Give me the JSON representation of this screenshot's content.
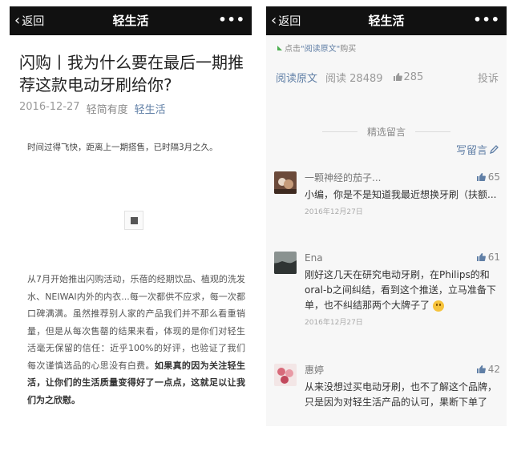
{
  "left": {
    "nav": {
      "back_label": "返回",
      "title": "轻生活",
      "more": "•••"
    },
    "article": {
      "title": "闪购丨我为什么要在最后一期推荐这款电动牙刷给你?",
      "date": "2016-12-27",
      "author": "轻简有度",
      "account": "轻生活",
      "intro": "时间过得飞快，距离上一期搭售，已时隔3月之久。",
      "body": "从7月开始推出闪购活动，乐蓓的经期饮品、植观的洗发水、NEIWAI内外的内衣...每一次都供不应求，每一次都口碑满满。虽然推荐别人家的产品我们并不那么看重销量，但是从每次售罄的结果来看，体现的是你们对轻生活毫无保留的信任：近乎100%的好评，也验证了我们每次谨慎选品的心思没有白费。",
      "body_strong": "如果真的因为关注轻生活，让你们的生活质量变得好了一点点，这就足以让我们为之欣慰。"
    }
  },
  "right": {
    "nav": {
      "back_label": "返回",
      "title": "轻生活",
      "more": "•••"
    },
    "read_original_hint": {
      "prefix": "点击",
      "link": "\"阅读原文\"",
      "suffix": "购买"
    },
    "stats": {
      "read_more": "阅读原文",
      "reads": "阅读 28489",
      "likes": "285",
      "report": "投诉"
    },
    "section_label": "精选留言",
    "write_comment": "写留言",
    "comments": [
      {
        "nick": "一颗神经的茄子...",
        "likes": "65",
        "text": "小编，你是不是知道我最近想换牙刷（扶额...",
        "date": "2016年12月27日"
      },
      {
        "nick": "Ena",
        "likes": "61",
        "text": "刚好这几天在研究电动牙刷，在Philips的和oral-b之间纠结，看到这个推送，立马准备下单，也不纠结那两个大牌子了",
        "date": "2016年12月27日"
      },
      {
        "nick": "惠婷",
        "likes": "42",
        "text": "从来没想过买电动牙刷，也不了解这个品牌，只是因为对轻生活产品的认可，果断下单了",
        "date": ""
      }
    ],
    "colors": {
      "link": "#607fa6",
      "navbar": "#111111"
    }
  }
}
